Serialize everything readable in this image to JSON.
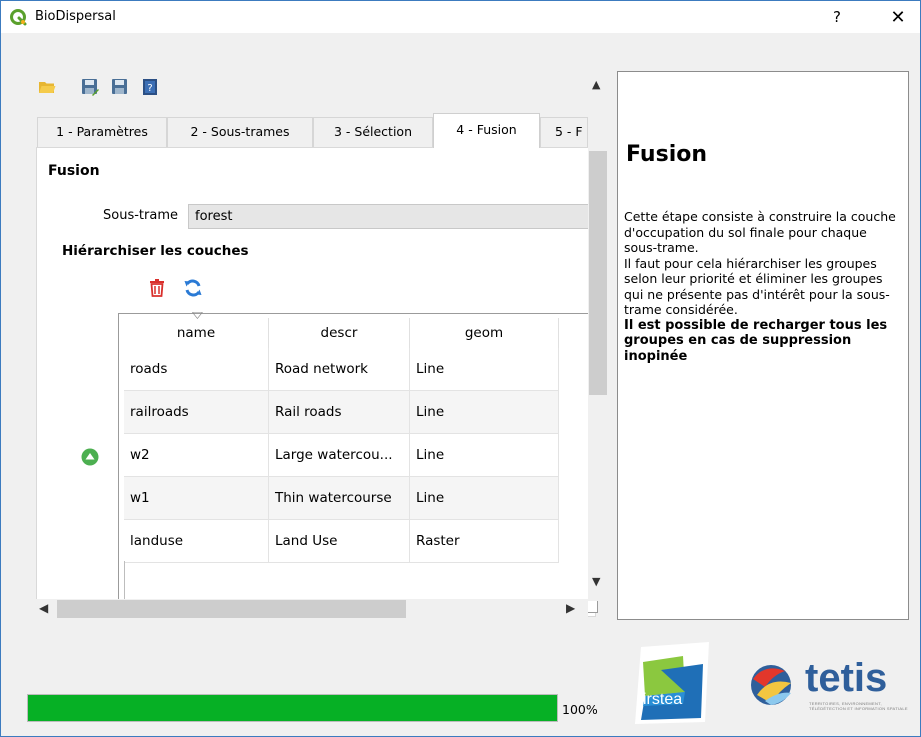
{
  "window": {
    "title": "BioDispersal",
    "help_label": "?",
    "close_label": "✕"
  },
  "toolbar": {
    "icons": [
      "folder-open-icon",
      "save-as-icon",
      "save-icon",
      "help-book-icon"
    ]
  },
  "tabs": [
    {
      "label": "1 - Paramètres",
      "active": false
    },
    {
      "label": "2 - Sous-trames",
      "active": false
    },
    {
      "label": "3 - Sélection",
      "active": false
    },
    {
      "label": "4 - Fusion",
      "active": true
    },
    {
      "label": "5 - F",
      "active": false
    }
  ],
  "fusion": {
    "heading": "Fusion",
    "subtrame_label": "Sous-trame",
    "subtrame_value": "forest",
    "hier_heading": "Hiérarchiser les couches"
  },
  "table": {
    "headers": [
      "name",
      "descr",
      "geom"
    ],
    "rows": [
      [
        "roads",
        "Road network",
        "Line"
      ],
      [
        "railroads",
        "Rail roads",
        "Line"
      ],
      [
        "w2",
        "Large watercou...",
        "Line"
      ],
      [
        "w1",
        "Thin watercourse",
        "Line"
      ],
      [
        "landuse",
        "Land Use",
        "Raster"
      ]
    ]
  },
  "help": {
    "title": "Fusion",
    "paragraphs": [
      " Cette étape consiste à construire la couche d'occupation du sol finale pour chaque sous-trame.",
      " Il faut pour cela hiérarchiser les groupes selon leur priorité et éliminer les groupes qui ne présente pas d'intérêt pour la sous-trame considérée."
    ],
    "bold_note": " Il est possible de recharger tous les groupes en cas de suppression inopinée"
  },
  "progress": {
    "value": 100,
    "label": "100%"
  },
  "logos": {
    "irstea": "irstea",
    "tetis": "tetis",
    "tetis_sub": "TERRITOIRES, ENVIRONNEMENT, TÉLÉDÉTECTION ET INFORMATION SPATIALE"
  },
  "colors": {
    "progress": "#06b025",
    "trash": "#d9302c",
    "refresh": "#2a7ad5",
    "up": "#4caf50",
    "tetis_blue": "#2f5f9b",
    "irstea_blue": "#1f6fb7"
  }
}
